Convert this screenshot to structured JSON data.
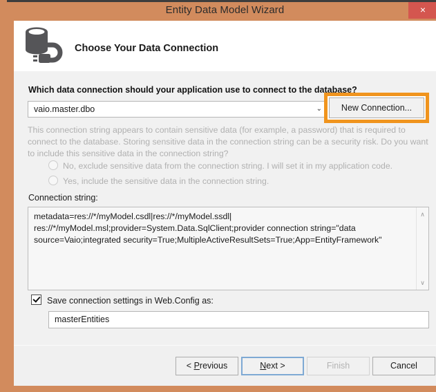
{
  "window": {
    "title": "Entity Data Model Wizard",
    "close_label": "×",
    "frame_color": "#d28b5d",
    "close_color": "#d4564f"
  },
  "header": {
    "title": "Choose Your Data Connection",
    "icon": "database-connection-icon"
  },
  "main": {
    "question_label": "Which data connection should your application use to connect to the database?",
    "connection_dropdown": {
      "value": "vaio.master.dbo",
      "arrow": "⌄"
    },
    "new_connection_button": "New Connection...",
    "annotation_color": "#f0941e",
    "sensitive_notice": "This connection string appears to contain sensitive data (for example, a password) that is required to connect to the database. Storing sensitive data in the connection string can be a security risk. Do you want to include this sensitive data in the connection string?",
    "radios": [
      {
        "label": "No, exclude sensitive data from the connection string. I will set it in my application code.",
        "selected": false,
        "disabled": true
      },
      {
        "label": "Yes, include the sensitive data in the connection string.",
        "selected": false,
        "disabled": true
      }
    ],
    "connection_string_label": "Connection string:",
    "connection_string_value": "metadata=res://*/myModel.csdl|res://*/myModel.ssdl|\nres://*/myModel.msl;provider=System.Data.SqlClient;provider connection string=\"data source=Vaio;integrated security=True;MultipleActiveResultSets=True;App=EntityFramework\"",
    "scroll_up": "∧",
    "scroll_down": "∨",
    "save_checkbox_label": "Save connection settings in Web.Config as:",
    "save_checkbox_checked": true,
    "entities_name_value": "masterEntities"
  },
  "footer": {
    "previous": {
      "prefix": "< ",
      "accel": "P",
      "suffix": "revious"
    },
    "next": {
      "prefix": "",
      "accel": "N",
      "suffix": "ext >"
    },
    "finish": "Finish",
    "cancel": "Cancel"
  }
}
